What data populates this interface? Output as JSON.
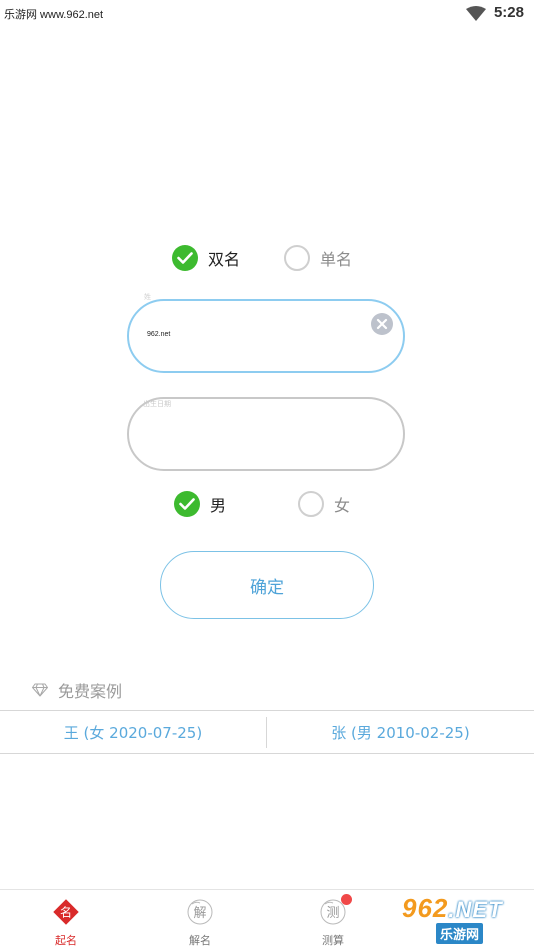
{
  "status_bar": {
    "watermark_text": "乐游网 www.962.net",
    "time": "5:28"
  },
  "name_type": {
    "options": [
      {
        "label": "双名",
        "checked": true
      },
      {
        "label": "单名",
        "checked": false
      }
    ]
  },
  "name_input": {
    "mark": "姓",
    "value": "962.net"
  },
  "birth_input": {
    "hint": "出生日期",
    "value": ""
  },
  "gender": {
    "options": [
      {
        "label": "男",
        "checked": true
      },
      {
        "label": "女",
        "checked": false
      }
    ]
  },
  "confirm_label": "确定",
  "cases": {
    "title": "免费案例",
    "items": [
      "王 (女 2020-07-25)",
      "张 (男 2010-02-25)"
    ]
  },
  "bottom_nav": {
    "items": [
      {
        "label": "起名",
        "active": true,
        "icon": "name-seal-icon"
      },
      {
        "label": "解名",
        "active": false,
        "icon": "explain-icon"
      },
      {
        "label": "测算",
        "active": false,
        "icon": "calculate-icon"
      }
    ]
  },
  "watermark_logo": {
    "line1_digits": "962",
    "line1_suffix": ".NET",
    "line2": "乐游网"
  },
  "colors": {
    "check_green": "#3dba2f",
    "accent_blue": "#4ea3d8",
    "active_red": "#d92a2a"
  }
}
